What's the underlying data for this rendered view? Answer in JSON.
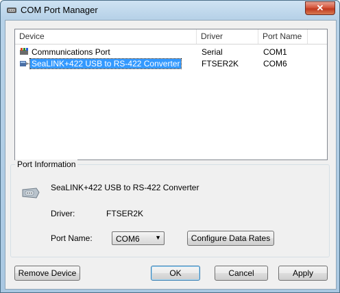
{
  "window": {
    "title": "COM Port Manager",
    "close_label": "✕"
  },
  "device_list": {
    "columns": [
      "Device",
      "Driver",
      "Port Name"
    ],
    "rows": [
      {
        "device": "Communications Port",
        "driver": "Serial",
        "port": "COM1",
        "icon": "serial-port-icon",
        "selected": false
      },
      {
        "device": "SeaLINK+422 USB to RS-422 Converter",
        "driver": "FTSER2K",
        "port": "COM6",
        "icon": "usb-serial-icon",
        "selected": true
      }
    ]
  },
  "port_info": {
    "group_title": "Port Information",
    "device_name": "SeaLINK+422 USB to RS-422 Converter",
    "driver_label": "Driver:",
    "driver_value": "FTSER2K",
    "port_name_label": "Port Name:",
    "port_name_value": "COM6",
    "configure_button": "Configure Data Rates",
    "icon": "serial-connector-icon"
  },
  "buttons": {
    "remove_device": "Remove Device",
    "ok": "OK",
    "cancel": "Cancel",
    "apply": "Apply"
  }
}
